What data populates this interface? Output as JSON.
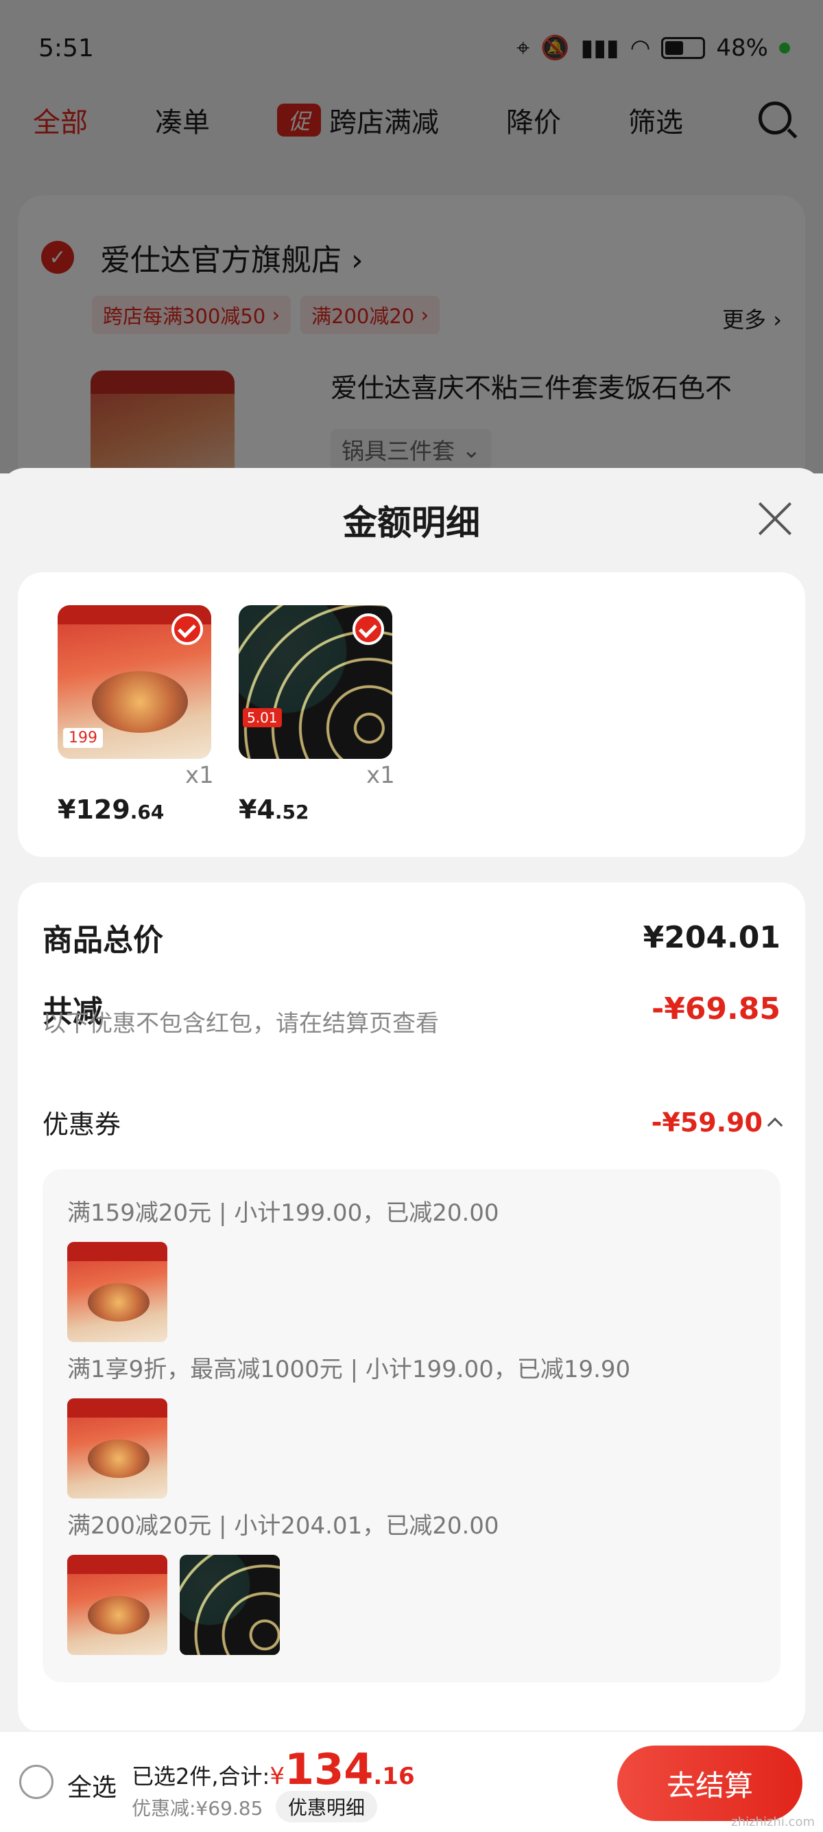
{
  "status_bar": {
    "time": "5:51",
    "battery": "48%"
  },
  "tabs": {
    "all": "全部",
    "bundle": "凑单",
    "promo_badge": "促",
    "cross_store": "跨店满减",
    "price_drop": "降价",
    "filter": "筛选"
  },
  "shop": {
    "name": "爱仕达官方旗舰店",
    "coupon1": "跨店每满300减50",
    "coupon2": "满200减20",
    "more": "更多",
    "product_title": "爱仕达喜庆不粘三件套麦饭石色不",
    "sku": "锅具三件套"
  },
  "sheet": {
    "title": "金额明细",
    "items": [
      {
        "price_int": "¥129",
        "price_dec": ".64",
        "qty": "x1"
      },
      {
        "price_int": "¥4",
        "price_dec": ".52",
        "qty": "x1"
      }
    ],
    "total_label": "商品总价",
    "total_value": "¥204.01",
    "discount_label": "共减",
    "discount_value": "-¥69.85",
    "note": "以下优惠不包含红包，请在结算页查看",
    "coupon_label": "优惠券",
    "coupon_value": "-¥59.90",
    "rules": [
      "满159减20元 | 小计199.00，已减20.00",
      "满1享9折，最高减1000元 | 小计199.00，已减19.90",
      "满200减20元 | 小计204.01，已减20.00"
    ]
  },
  "bottom": {
    "select_all": "全选",
    "summary_prefix": "已选2件,合计:",
    "yen": "¥",
    "amount_int": "134",
    "amount_dec": ".16",
    "saved": "优惠减:¥69.85",
    "detail_pill": "优惠明细",
    "checkout": "去结算"
  },
  "colors": {
    "accent": "#e1251b",
    "background": "#f2f2f2"
  }
}
